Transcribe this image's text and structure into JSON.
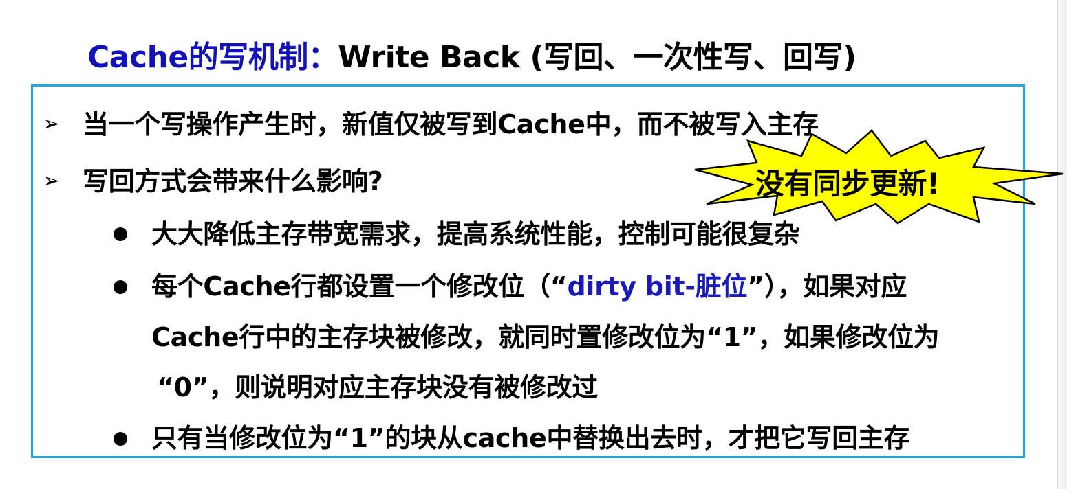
{
  "title": {
    "part1": "Cache的写机制：",
    "part2": "Write Back (写回、一次性写、回写)"
  },
  "bullets": {
    "b1": "当一个写操作产生时，新值仅被写到Cache中，而不被写入主存",
    "b2": "写回方式会带来什么影响?",
    "sub1": "大大降低主存带宽需求，提高系统性能，控制可能很复杂",
    "sub2_line1_a": "每个Cache行都设置一个修改位（“",
    "sub2_line1_hl": "dirty bit-脏位",
    "sub2_line1_b": "”），如果对应",
    "sub2_line2": "Cache行中的主存块被修改，就同时置修改位为“1”，如果修改位为",
    "sub2_line3": "“0”，则说明对应主存块没有被修改过",
    "sub3": "只有当修改位为“1”的块从cache中替换出去时，才把它写回主存"
  },
  "callout": {
    "text": "没有同步更新!"
  },
  "colors": {
    "title_blue": "#1212b8",
    "highlight_blue": "#1a1ab4",
    "frame_border": "#21a9de",
    "burst_fill": "#ffff00",
    "burst_stroke": "#000000"
  },
  "icons": {
    "main_bullet": "arrow-bullet-icon",
    "sub_bullet": "dot-bullet-icon",
    "callout_shape": "explosion-burst-icon"
  }
}
